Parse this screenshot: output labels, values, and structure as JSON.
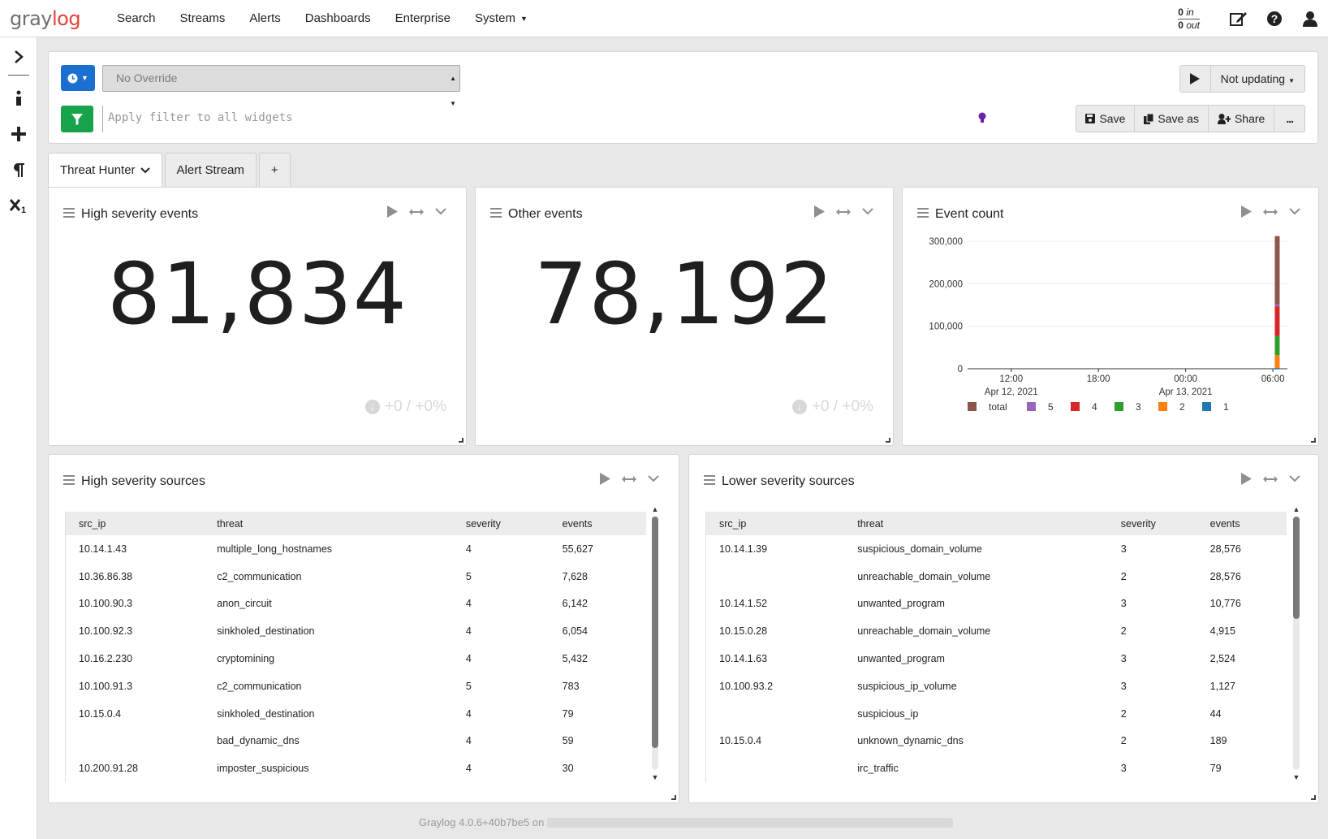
{
  "nav": {
    "logo_gray": "gray",
    "logo_log": "log",
    "links": [
      "Search",
      "Streams",
      "Alerts",
      "Dashboards",
      "Enterprise",
      "System"
    ],
    "throughput_in_value": "0",
    "throughput_in_label": "in",
    "throughput_out_value": "0",
    "throughput_out_label": "out"
  },
  "search": {
    "override_placeholder": "No Override",
    "filter_placeholder": "Apply filter to all widgets",
    "refresh_label": "Not updating",
    "save_label": "Save",
    "save_as_label": "Save as",
    "share_label": "Share",
    "more_label": "..."
  },
  "tabs": [
    {
      "label": "Threat Hunter",
      "active": true
    },
    {
      "label": "Alert Stream",
      "active": false
    },
    {
      "label": "+",
      "active": false
    }
  ],
  "widgets": {
    "high_events": {
      "title": "High severity events",
      "value": "81,834",
      "trend": "+0 / +0%"
    },
    "other_events": {
      "title": "Other events",
      "value": "78,192",
      "trend": "+0 / +0%"
    },
    "event_count": {
      "title": "Event count"
    },
    "high_sources": {
      "title": "High severity sources",
      "columns": [
        "src_ip",
        "threat",
        "severity",
        "events"
      ],
      "rows": [
        [
          "10.14.1.43",
          "multiple_long_hostnames",
          "4",
          "55,627"
        ],
        [
          "10.36.86.38",
          "c2_communication",
          "5",
          "7,628"
        ],
        [
          "10.100.90.3",
          "anon_circuit",
          "4",
          "6,142"
        ],
        [
          "10.100.92.3",
          "sinkholed_destination",
          "4",
          "6,054"
        ],
        [
          "10.16.2.230",
          "cryptomining",
          "4",
          "5,432"
        ],
        [
          "10.100.91.3",
          "c2_communication",
          "5",
          "783"
        ],
        [
          "10.15.0.4",
          "sinkholed_destination",
          "4",
          "79"
        ],
        [
          "",
          "bad_dynamic_dns",
          "4",
          "59"
        ],
        [
          "10.200.91.28",
          "imposter_suspicious",
          "4",
          "30"
        ]
      ]
    },
    "lower_sources": {
      "title": "Lower severity sources",
      "columns": [
        "src_ip",
        "threat",
        "severity",
        "events"
      ],
      "rows": [
        [
          "10.14.1.39",
          "suspicious_domain_volume",
          "3",
          "28,576"
        ],
        [
          "",
          "unreachable_domain_volume",
          "2",
          "28,576"
        ],
        [
          "10.14.1.52",
          "unwanted_program",
          "3",
          "10,776"
        ],
        [
          "10.15.0.28",
          "unreachable_domain_volume",
          "2",
          "4,915"
        ],
        [
          "10.14.1.63",
          "unwanted_program",
          "3",
          "2,524"
        ],
        [
          "10.100.93.2",
          "suspicious_ip_volume",
          "3",
          "1,127"
        ],
        [
          "",
          "suspicious_ip",
          "2",
          "44"
        ],
        [
          "10.15.0.4",
          "unknown_dynamic_dns",
          "2",
          "189"
        ],
        [
          "",
          "irc_traffic",
          "3",
          "79"
        ]
      ]
    }
  },
  "chart_data": {
    "type": "bar",
    "stacked": true,
    "title": "",
    "ylim": [
      0,
      300000
    ],
    "yticks": [
      "0",
      "100,000",
      "200,000",
      "300,000"
    ],
    "xticks": [
      {
        "line1": "12:00",
        "line2": "Apr 12, 2021"
      },
      {
        "line1": "18:00",
        "line2": ""
      },
      {
        "line1": "00:00",
        "line2": "Apr 13, 2021"
      },
      {
        "line1": "06:00",
        "line2": ""
      }
    ],
    "x_domain_hours": [
      9,
      31
    ],
    "bar_x_hours": 30.3,
    "series": [
      {
        "name": "1",
        "color": "#1f77b4",
        "value": 2000
      },
      {
        "name": "2",
        "color": "#ff7f0e",
        "value": 30000
      },
      {
        "name": "3",
        "color": "#2ca02c",
        "value": 45000
      },
      {
        "name": "4",
        "color": "#d62728",
        "value": 70000
      },
      {
        "name": "5",
        "color": "#9467bd",
        "value": 5000
      },
      {
        "name": "total",
        "color": "#8c564b",
        "value": 160000
      }
    ],
    "legend_order": [
      "total",
      "5",
      "4",
      "3",
      "2",
      "1"
    ]
  },
  "footer": {
    "text": "Graylog 4.0.6+40b7be5 on"
  }
}
